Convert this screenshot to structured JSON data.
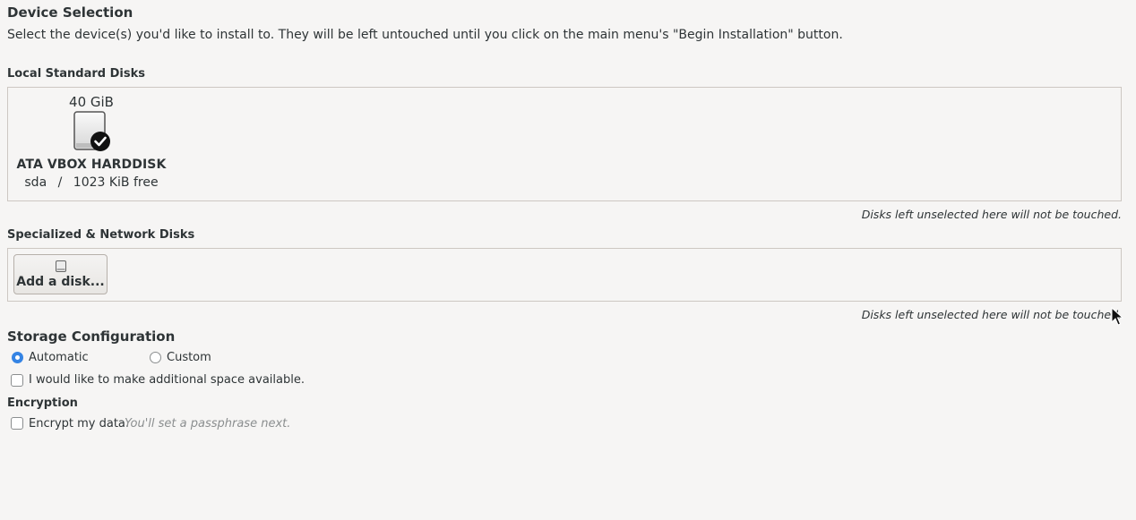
{
  "header": {
    "title": "Device Selection",
    "subtitle": "Select the device(s) you'd like to install to.  They will be left untouched until you click on the main menu's \"Begin Installation\" button."
  },
  "local_disks": {
    "label": "Local Standard Disks",
    "disks": [
      {
        "size": "40 GiB",
        "name": "ATA VBOX HARDDISK",
        "device": "sda",
        "separator": "/",
        "free": "1023 KiB free",
        "selected": true
      }
    ],
    "note": "Disks left unselected here will not be touched."
  },
  "network_disks": {
    "label": "Specialized & Network Disks",
    "add_button": "Add a disk...",
    "note": "Disks left unselected here will not be touched."
  },
  "storage_config": {
    "label": "Storage Configuration",
    "options": [
      "Automatic",
      "Custom"
    ],
    "selected": "Automatic",
    "extra_space_label": "I would like to make additional space available.",
    "extra_space_checked": false
  },
  "encryption": {
    "label": "Encryption",
    "checkbox_label": "Encrypt my data.",
    "hint": "You'll set a passphrase next.",
    "checked": false
  },
  "colors": {
    "accent": "#3584e4",
    "background": "#f6f5f4",
    "text": "#2e3436"
  }
}
